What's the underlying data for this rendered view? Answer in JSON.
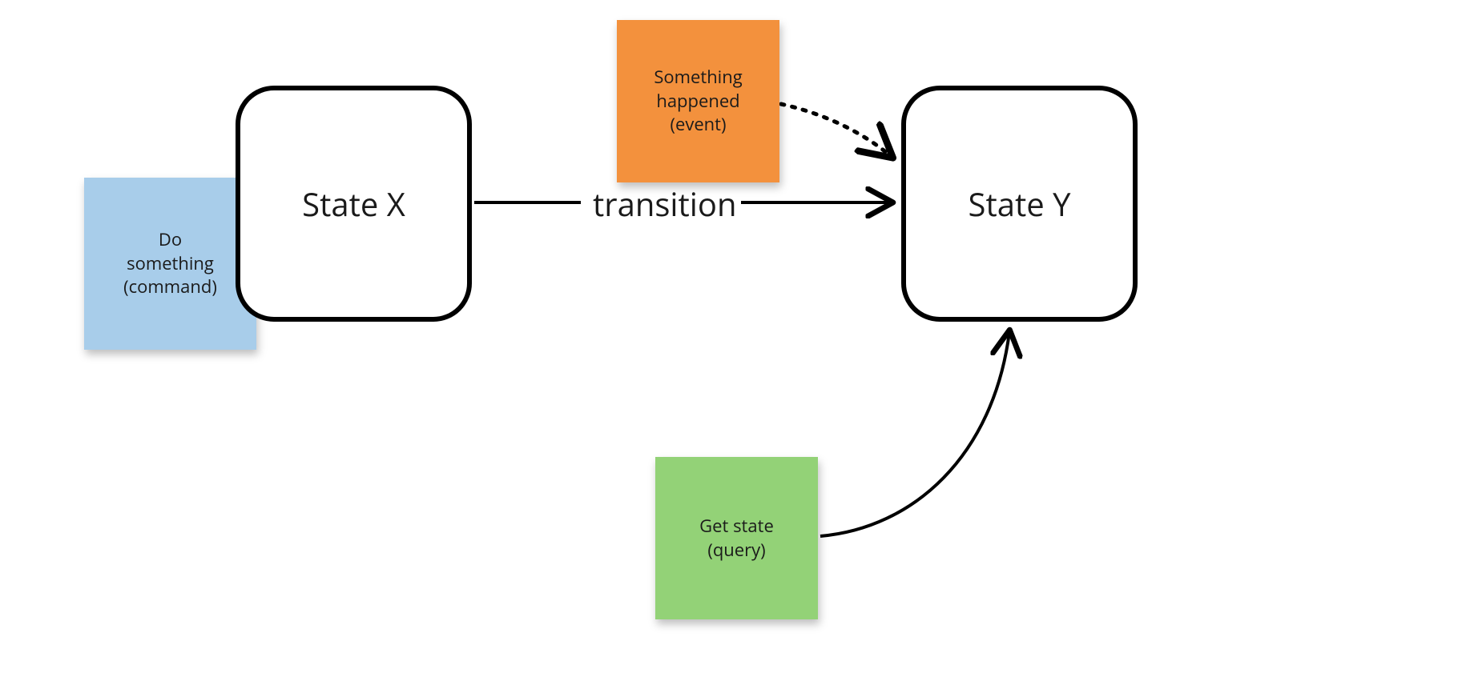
{
  "diagram": {
    "state_x": {
      "label": "State X"
    },
    "state_y": {
      "label": "State Y"
    },
    "transition_label": "transition",
    "command_note": {
      "line1": "Do",
      "line2": "something",
      "line3": "(command)"
    },
    "event_note": {
      "line1": "Something",
      "line2": "happened",
      "line3": "(event)"
    },
    "query_note": {
      "line1": "Get state",
      "line2": "(query)"
    },
    "colors": {
      "command": "#a8cdea",
      "event": "#f3913d",
      "query": "#93d277",
      "stroke": "#000000"
    }
  }
}
